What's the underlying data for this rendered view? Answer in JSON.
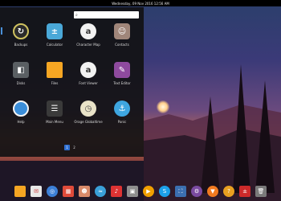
{
  "topbar": {
    "datetime": "Wednesday, 09 Nov 2016 12:56 AM"
  },
  "search": {
    "icon": "search-icon",
    "value": ""
  },
  "apps": [
    {
      "label": "Backups",
      "icon": "backup-icon",
      "color": "#2b2b2b"
    },
    {
      "label": "Calculator",
      "icon": "calculator-icon",
      "color": "#4aa8d8"
    },
    {
      "label": "Character Map",
      "icon": "character-map-icon",
      "color": "#f2f2f2"
    },
    {
      "label": "Contacts",
      "icon": "contacts-icon",
      "color": "#a0867a"
    },
    {
      "label": "Disks",
      "icon": "disks-icon",
      "color": "#5a5f63"
    },
    {
      "label": "Files",
      "icon": "folder-icon",
      "color": "#f6a623"
    },
    {
      "label": "Font Viewer",
      "icon": "font-viewer-icon",
      "color": "#f2f2f2"
    },
    {
      "label": "Text Editor",
      "icon": "text-editor-icon",
      "color": "#8e4a9e"
    },
    {
      "label": "Help",
      "icon": "help-icon",
      "color": "#3b8ed9"
    },
    {
      "label": "Main Menu",
      "icon": "main-menu-icon",
      "color": "#3a3a3a"
    },
    {
      "label": "Orage Globaltime",
      "icon": "clock-icon",
      "color": "#e9e3c8"
    },
    {
      "label": "Panic",
      "icon": "anchor-icon",
      "color": "#3ea6e0"
    }
  ],
  "pager": [
    "1",
    "2"
  ],
  "dock": [
    {
      "icon": "folder-icon",
      "color": "#f6a623"
    },
    {
      "icon": "mail-icon",
      "color": "#e8e8e8"
    },
    {
      "icon": "web-browser-icon",
      "color": "#3c7fd6"
    },
    {
      "icon": "calendar-icon",
      "color": "#e04b3a"
    },
    {
      "icon": "photos-icon",
      "color": "#d98a6a"
    },
    {
      "icon": "video-icon",
      "color": "#3aa0d8"
    },
    {
      "icon": "music-icon",
      "color": "#d33"
    },
    {
      "icon": "photo-viewer-icon",
      "color": "#8e8e8e"
    },
    {
      "icon": "media-player-icon",
      "color": "#f0a000"
    },
    {
      "icon": "skype-icon",
      "color": "#1ba0e8"
    },
    {
      "icon": "screenshot-icon",
      "color": "#3b6fb0"
    },
    {
      "icon": "settings-icon",
      "color": "#7a4aa0"
    },
    {
      "icon": "software-center-icon",
      "color": "#f07a20"
    },
    {
      "icon": "help-icon",
      "color": "#e8a020"
    },
    {
      "icon": "calculator-icon",
      "color": "#cc2a2a"
    },
    {
      "icon": "trash-icon",
      "color": "#7a7a7a"
    }
  ]
}
